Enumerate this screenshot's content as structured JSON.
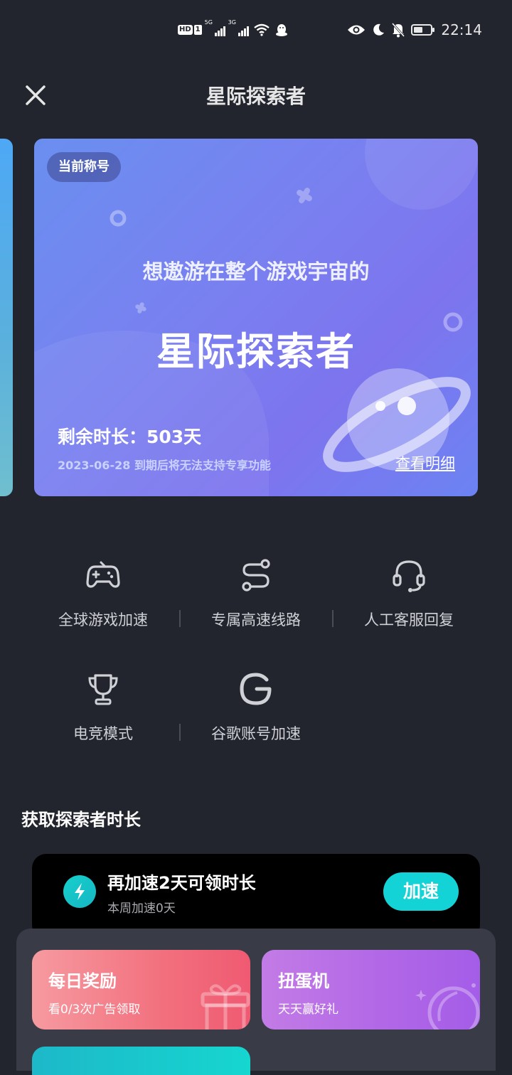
{
  "status_bar": {
    "hd_label": "HD",
    "sim1": "1",
    "net1": "5G",
    "net2": "3G",
    "time": "22:14",
    "battery_level": 0.45
  },
  "header": {
    "title": "星际探索者"
  },
  "title_card": {
    "badge": "当前称号",
    "subtitle": "想遨游在整个游戏宇宙的",
    "title": "星际探索者",
    "remaining": "剩余时长：503天",
    "expire_note": "2023-06-28 到期后将无法支持专享功能",
    "detail_link": "查看明细"
  },
  "features": [
    {
      "label": "全球游戏加速",
      "icon": "gamepad-icon"
    },
    {
      "label": "专属高速线路",
      "icon": "route-icon"
    },
    {
      "label": "人工客服回复",
      "icon": "headset-icon"
    },
    {
      "label": "电竞模式",
      "icon": "trophy-icon"
    },
    {
      "label": "谷歌账号加速",
      "icon": "google-icon"
    }
  ],
  "section": {
    "title": "获取探索者时长"
  },
  "task": {
    "title": "再加速2天可领时长",
    "subtitle": "本周加速0天",
    "button": "加速",
    "icon": "lightning-icon"
  },
  "rewards": [
    {
      "title": "每日奖励",
      "subtitle": "看0/3次广告领取",
      "icon": "gift-icon",
      "color": "#f2707e"
    },
    {
      "title": "扭蛋机",
      "subtitle": "天天赢好礼",
      "icon": "planet-icon",
      "color": "#b066e6"
    }
  ],
  "colors": {
    "background": "#22252d",
    "accent": "#14d3d6",
    "card": "#7a7ff0"
  }
}
